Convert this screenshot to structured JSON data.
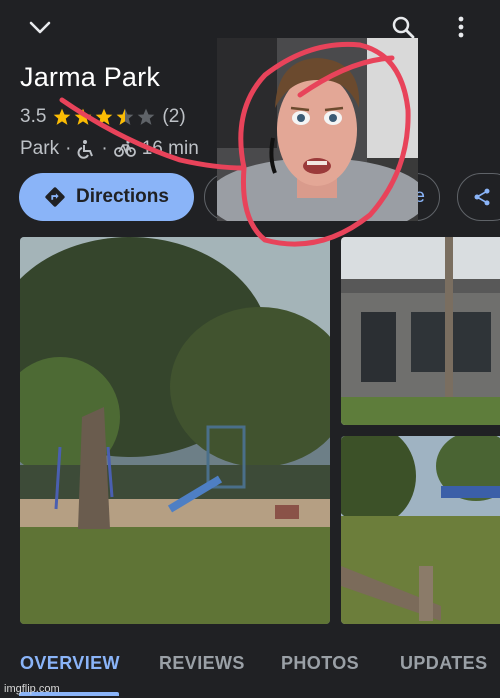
{
  "header": {
    "back_icon": "chevron-down-icon",
    "search_icon": "search-icon",
    "more_icon": "more-vertical-icon"
  },
  "place": {
    "name": "Jarma Park",
    "rating": "3.5",
    "rating_value": 3.5,
    "review_count": "(2)",
    "category": "Park",
    "separator": "·",
    "travel_time": "16 min"
  },
  "actions": {
    "directions_label": "Directions",
    "partial_pill_label": "e",
    "share_icon": "share-icon"
  },
  "tabs": [
    {
      "label": "OVERVIEW",
      "active": true
    },
    {
      "label": "REVIEWS",
      "active": false
    },
    {
      "label": "PHOTOS",
      "active": false
    },
    {
      "label": "UPDATES",
      "active": false
    }
  ],
  "watermark": "imgflip.com",
  "colors": {
    "background": "#202124",
    "accent": "#8ab4f8",
    "star": "#fbbc04",
    "annotation": "#e8435a"
  }
}
